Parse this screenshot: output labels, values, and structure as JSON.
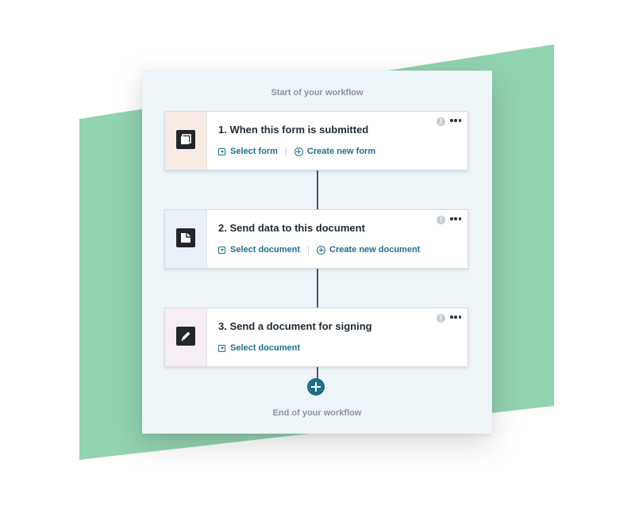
{
  "workflow": {
    "start_label": "Start of your workflow",
    "end_label": "End of your workflow",
    "info_glyph": "!",
    "steps": [
      {
        "title": "1. When this form is submitted",
        "icon": "form-icon",
        "tint": "#f7ebe4",
        "actions": [
          {
            "label": "Select form",
            "icon": "dropdown-square-icon"
          },
          {
            "label": "Create new form",
            "icon": "plus-circle-icon"
          }
        ]
      },
      {
        "title": "2. Send data to this document",
        "icon": "document-icon",
        "tint": "#e9f0f8",
        "actions": [
          {
            "label": "Select document",
            "icon": "dropdown-square-icon"
          },
          {
            "label": "Create new document",
            "icon": "plus-circle-icon"
          }
        ]
      },
      {
        "title": "3. Send a document for signing",
        "icon": "pen-icon",
        "tint": "#f6edf5",
        "actions": [
          {
            "label": "Select document",
            "icon": "dropdown-square-icon"
          }
        ]
      }
    ]
  },
  "colors": {
    "accent": "#1e6f8a",
    "background_shape": "#92d3b0",
    "panel": "#eef5f9"
  }
}
